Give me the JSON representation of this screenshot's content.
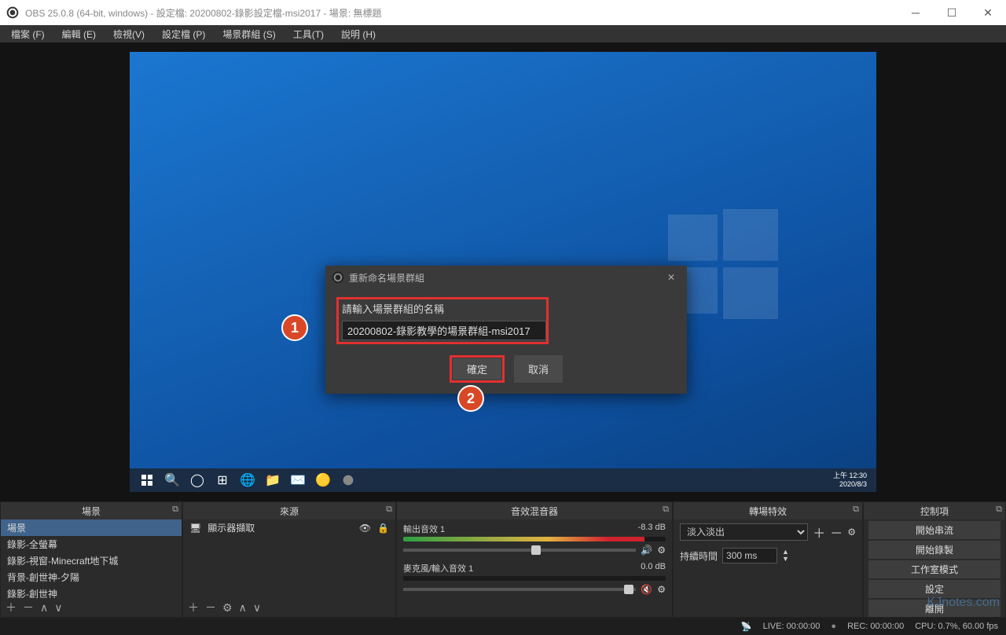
{
  "window": {
    "title": "OBS 25.0.8 (64-bit, windows) - 設定檔: 20200802-錄影設定檔-msi2017 - 場景: 無標題"
  },
  "menu": {
    "file": "檔案 (F)",
    "edit": "編輯 (E)",
    "view": "檢視(V)",
    "profile": "設定檔 (P)",
    "scene_collection": "場景群組 (S)",
    "tools": "工具(T)",
    "help": "說明 (H)"
  },
  "dialog": {
    "title": "重新命名場景群組",
    "prompt": "請輸入場景群組的名稱",
    "input_value": "20200802-錄影教學的場景群組-msi2017",
    "ok": "確定",
    "cancel": "取消"
  },
  "annotations": {
    "one": "1",
    "two": "2"
  },
  "panels": {
    "scenes": {
      "title": "場景",
      "items": [
        "場景",
        "錄影-全螢幕",
        "錄影-視窗-Minecraft地下城",
        "背景-創世神-夕陽",
        "錄影-創世神"
      ]
    },
    "sources": {
      "title": "來源",
      "item": "顯示器擷取"
    },
    "mixer": {
      "title": "音效混音器",
      "out": {
        "name": "輸出音效 1",
        "db": "-8.3 dB"
      },
      "mic": {
        "name": "麥克風/輸入音效 1",
        "db": "0.0 dB"
      }
    },
    "transitions": {
      "title": "轉場特效",
      "effect": "淡入淡出",
      "duration_label": "持續時間",
      "duration": "300 ms"
    },
    "controls": {
      "title": "控制項",
      "stream": "開始串流",
      "record": "開始錄製",
      "studio": "工作室模式",
      "settings": "設定",
      "exit": "離開"
    }
  },
  "taskbar": {
    "time1": "上午 12:30",
    "time2": "2020/8/3"
  },
  "status": {
    "live": "LIVE: 00:00:00",
    "rec": "REC: 00:00:00",
    "cpu": "CPU: 0.7%, 60.00 fps"
  },
  "watermark": "KJnotes.com"
}
